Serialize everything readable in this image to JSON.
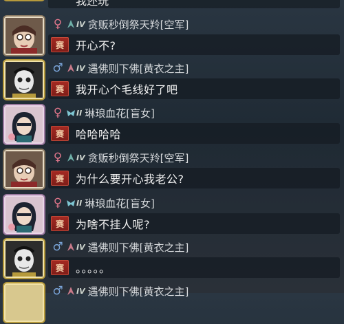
{
  "top_partial": {
    "text": "我还玩"
  },
  "messages": [
    {
      "gender": "♀",
      "rank": "IV",
      "name": "贪贩秒倒祭天羚[空军]",
      "tag": "赛",
      "text": "开心不?"
    },
    {
      "gender": "♂",
      "rank": "IV",
      "name": "遇佛则下佛[黄衣之主]",
      "tag": "赛",
      "text": "我开心个毛线好了吧"
    },
    {
      "gender": "♀",
      "rank": "II",
      "name": "琳琅血花[盲女]",
      "tag": "赛",
      "text": "哈哈哈哈"
    },
    {
      "gender": "♀",
      "rank": "IV",
      "name": "贪贩秒倒祭天羚[空军]",
      "tag": "赛",
      "text": "为什么要开心我老公?"
    },
    {
      "gender": "♀",
      "rank": "II",
      "name": "琳琅血花[盲女]",
      "tag": "赛",
      "text": "为啥不挂人呢?"
    },
    {
      "gender": "♂",
      "rank": "IV",
      "name": "遇佛则下佛[黄衣之主]",
      "tag": "赛",
      "text": "。。。。。"
    }
  ],
  "bottom_partial": {
    "gender": "♂",
    "rank": "IV",
    "name": "遇佛则下佛[黄衣之主]"
  },
  "colors": {
    "female": "#e0768b",
    "male": "#7aa4d8",
    "tag_bg": "#a52a22"
  },
  "icons": {
    "avatar_air_force": "pilot-portrait-icon",
    "avatar_yellow_king": "yellow-king-portrait-icon",
    "avatar_blind_girl": "blind-girl-portrait-icon"
  }
}
